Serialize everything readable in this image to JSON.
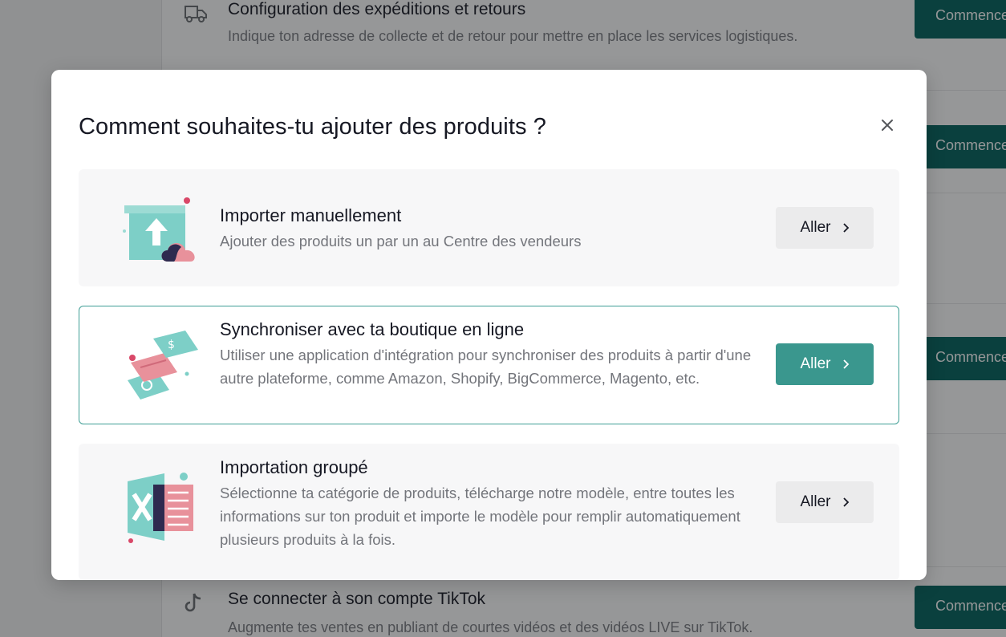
{
  "background": {
    "tasks": [
      {
        "title": "Configuration des expéditions et retours",
        "description": "Indique ton adresse de collecte et de retour pour mettre en place les services logistiques.",
        "icon": "truck-icon"
      },
      {
        "title": "Se connecter à son compte TikTok",
        "description": "Augmente tes ventes en publiant de courtes vidéos et des vidéos LIVE sur TikTok.",
        "icon": "tiktok-icon"
      }
    ],
    "button_label": "Commencer"
  },
  "modal": {
    "title": "Comment souhaites-tu ajouter des produits ?",
    "close_icon": "close-icon",
    "options": [
      {
        "title": "Importer manuellement",
        "description": "Ajouter des produits un par un au Centre des vendeurs",
        "button": "Aller",
        "icon": "upload-box-icon",
        "selected": false
      },
      {
        "title": "Synchroniser avec ta boutique en ligne",
        "description": "Utiliser une application d'intégration pour synchroniser des produits à partir d'une autre plateforme, comme Amazon, Shopify, BigCommerce, Magento, etc.",
        "button": "Aller",
        "icon": "sync-cards-icon",
        "selected": true
      },
      {
        "title": "Importation groupé",
        "description": "Sélectionne ta catégorie de produits, télécharge notre modèle, entre toutes les informations sur ton produit et importe le modèle pour remplir automatiquement plusieurs produits à la fois.",
        "button": "Aller",
        "icon": "excel-sheet-icon",
        "selected": false
      }
    ]
  },
  "colors": {
    "accent": "#3a978e",
    "dark_accent": "#00615c"
  }
}
